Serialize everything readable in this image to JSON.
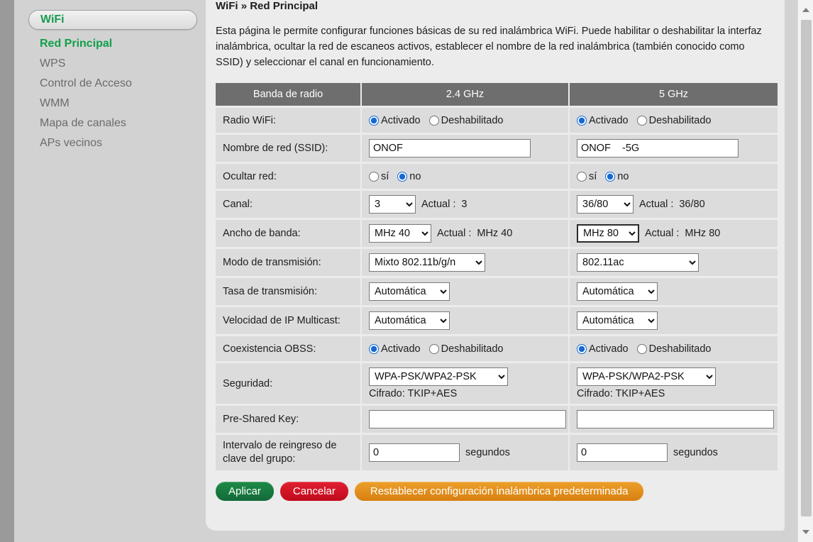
{
  "sidebar": {
    "section_label": "WiFi",
    "items": [
      {
        "label": "Red Principal",
        "active": true
      },
      {
        "label": "WPS",
        "active": false
      },
      {
        "label": "Control de Acceso",
        "active": false
      },
      {
        "label": "WMM",
        "active": false
      },
      {
        "label": "Mapa de canales",
        "active": false
      },
      {
        "label": "APs vecinos",
        "active": false
      }
    ]
  },
  "page": {
    "breadcrumb": "WiFi » Red Principal",
    "intro": "Esta página le permite configurar funciones básicas de su red inalámbrica WiFi. Puede habilitar o deshabilitar la interfaz inalámbrica, ocultar la red de escaneos activos, establecer el nombre de la red inalámbrica (también conocido como SSID) y seleccionar el canal en funcionamiento."
  },
  "table": {
    "headers": [
      "Banda de radio",
      "2.4 GHz",
      "5 GHz"
    ],
    "labels": {
      "radio": "Radio WiFi:",
      "ssid": "Nombre de red (SSID):",
      "hide": "Ocultar red:",
      "channel": "Canal:",
      "bandwidth": "Ancho de banda:",
      "mode": "Modo de transmisión:",
      "rate": "Tasa de transmisión:",
      "multicast": "Velocidad de IP Multicast:",
      "obss": "Coexistencia OBSS:",
      "security": "Seguridad:",
      "psk": "Pre-Shared Key:",
      "rekey": "Intervalo de reingreso de clave del grupo:"
    },
    "common": {
      "enabled": "Activado",
      "disabled": "Deshabilitado",
      "yes": "sí",
      "no": "no",
      "actual": "Actual :",
      "seconds": "segundos"
    },
    "band24": {
      "radio_selected": "Activado",
      "ssid_value": "ONOF",
      "hide_selected": "no",
      "channel_value": "3",
      "channel_actual": "3",
      "bandwidth_value": "MHz 40",
      "bandwidth_actual": "MHz 40",
      "mode_value": "Mixto 802.11b/g/n",
      "rate_value": "Automática",
      "multicast_value": "Automática",
      "obss_selected": "Activado",
      "security_value": "WPA-PSK/WPA2-PSK",
      "cipher_text": "Cifrado: TKIP+AES",
      "psk_value": "",
      "rekey_value": "0"
    },
    "band5": {
      "radio_selected": "Activado",
      "ssid_value": "ONOF    -5G",
      "hide_selected": "no",
      "channel_value": "36/80",
      "channel_actual": "36/80",
      "bandwidth_value": "MHz 80",
      "bandwidth_actual": "MHz 80",
      "mode_value": "802.11ac",
      "rate_value": "Automática",
      "multicast_value": "Automática",
      "obss_selected": "Activado",
      "security_value": "WPA-PSK/WPA2-PSK",
      "cipher_text": "Cifrado: TKIP+AES",
      "psk_value": "",
      "rekey_value": "0"
    }
  },
  "buttons": {
    "apply": "Aplicar",
    "cancel": "Cancelar",
    "reset": "Restablecer configuración inalámbrica predeterminada"
  },
  "colors": {
    "accent_green": "#10a04a",
    "header_gray": "#6e6e6e",
    "apply_green": "#1e8b45",
    "cancel_red": "#e02030",
    "reset_orange": "#eda02a",
    "radio_blue": "#1669d6"
  }
}
